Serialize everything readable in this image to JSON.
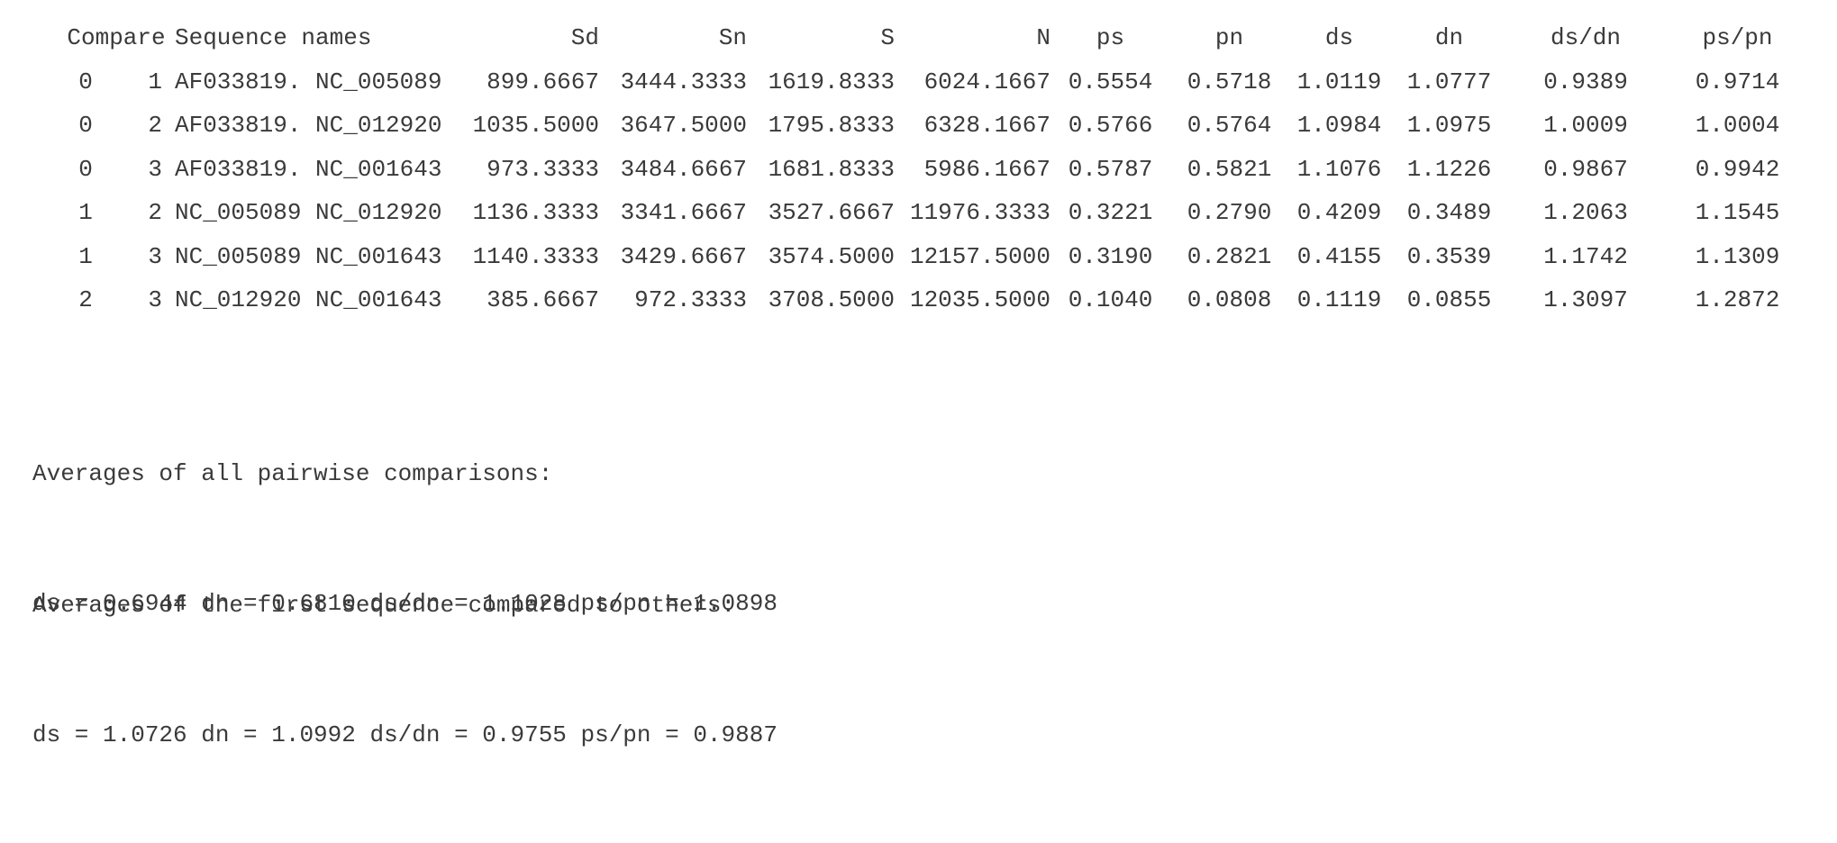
{
  "table": {
    "headers": {
      "compare": "Compare",
      "sequence_names": "Sequence names",
      "sd": "Sd",
      "sn": "Sn",
      "s": "S",
      "n": "N",
      "ps": "ps",
      "pn": "pn",
      "ds": "ds",
      "dn": "dn",
      "ds_dn": "ds/dn",
      "ps_pn": "ps/pn"
    },
    "rows": [
      {
        "i": "0",
        "j": "1",
        "seq_a": "AF033819.",
        "seq_b": "NC_005089",
        "sd": "899.6667",
        "sn": "3444.3333",
        "s": "1619.8333",
        "n": "6024.1667",
        "ps": "0.5554",
        "pn": "0.5718",
        "ds": "1.0119",
        "dn": "1.0777",
        "ds_dn": "0.9389",
        "ps_pn": "0.9714"
      },
      {
        "i": "0",
        "j": "2",
        "seq_a": "AF033819.",
        "seq_b": "NC_012920",
        "sd": "1035.5000",
        "sn": "3647.5000",
        "s": "1795.8333",
        "n": "6328.1667",
        "ps": "0.5766",
        "pn": "0.5764",
        "ds": "1.0984",
        "dn": "1.0975",
        "ds_dn": "1.0009",
        "ps_pn": "1.0004"
      },
      {
        "i": "0",
        "j": "3",
        "seq_a": "AF033819.",
        "seq_b": "NC_001643",
        "sd": "973.3333",
        "sn": "3484.6667",
        "s": "1681.8333",
        "n": "5986.1667",
        "ps": "0.5787",
        "pn": "0.5821",
        "ds": "1.1076",
        "dn": "1.1226",
        "ds_dn": "0.9867",
        "ps_pn": "0.9942"
      },
      {
        "i": "1",
        "j": "2",
        "seq_a": "NC_005089",
        "seq_b": "NC_012920",
        "sd": "1136.3333",
        "sn": "3341.6667",
        "s": "3527.6667",
        "n": "11976.3333",
        "ps": "0.3221",
        "pn": "0.2790",
        "ds": "0.4209",
        "dn": "0.3489",
        "ds_dn": "1.2063",
        "ps_pn": "1.1545"
      },
      {
        "i": "1",
        "j": "3",
        "seq_a": "NC_005089",
        "seq_b": "NC_001643",
        "sd": "1140.3333",
        "sn": "3429.6667",
        "s": "3574.5000",
        "n": "12157.5000",
        "ps": "0.3190",
        "pn": "0.2821",
        "ds": "0.4155",
        "dn": "0.3539",
        "ds_dn": "1.1742",
        "ps_pn": "1.1309"
      },
      {
        "i": "2",
        "j": "3",
        "seq_a": "NC_012920",
        "seq_b": "NC_001643",
        "sd": "385.6667",
        "sn": "972.3333",
        "s": "3708.5000",
        "n": "12035.5000",
        "ps": "0.1040",
        "pn": "0.0808",
        "ds": "0.1119",
        "dn": "0.0855",
        "ds_dn": "1.3097",
        "ps_pn": "1.2872"
      }
    ]
  },
  "averages_all": {
    "heading": "Averages of all pairwise comparisons:",
    "values": "ds = 0.6944 dn = 0.6810 ds/dn = 1.1028 ps/pn = 1.0898"
  },
  "averages_first": {
    "heading": "Averages of the first sequence compared to others:",
    "values": "ds = 1.0726 dn = 1.0992 ds/dn = 0.9755 ps/pn = 0.9887"
  }
}
